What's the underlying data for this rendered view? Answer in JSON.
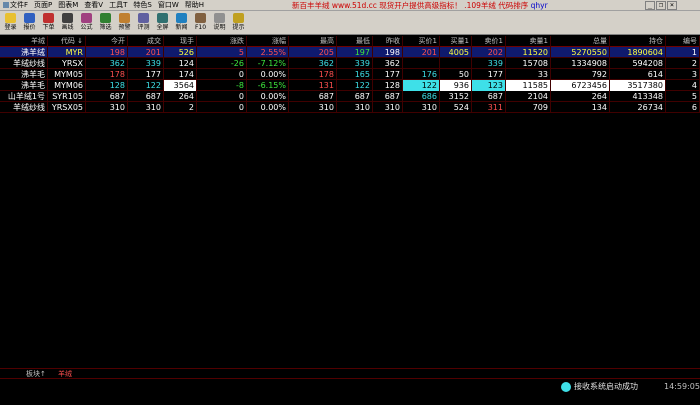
{
  "menu": [
    {
      "label": "文件F"
    },
    {
      "label": "页面P"
    },
    {
      "label": "图表M"
    },
    {
      "label": "查看V"
    },
    {
      "label": "工具T"
    },
    {
      "label": "特色S"
    },
    {
      "label": "窗口W"
    },
    {
      "label": "帮助H"
    }
  ],
  "promo": {
    "text1": "新百丰羊绒 www.51d.cc 现货开户提供高级指标！ .109羊绒 代码排序",
    "text2": "qhyr"
  },
  "window_controls": {
    "minimize": "_",
    "restore": "❐",
    "close": "×"
  },
  "toolbar": [
    {
      "label": "登录",
      "color": "#e8c030"
    },
    {
      "label": "报价",
      "color": "#3060c0"
    },
    {
      "label": "下单",
      "color": "#c03030"
    },
    {
      "label": "画线",
      "color": "#404040"
    },
    {
      "label": "公式",
      "color": "#a04080"
    },
    {
      "label": "筛选",
      "color": "#308030"
    },
    {
      "label": "预警",
      "color": "#c08030"
    },
    {
      "label": "评测",
      "color": "#6060a0"
    },
    {
      "label": "全屏",
      "color": "#307070"
    },
    {
      "label": "新闻",
      "color": "#2080c0"
    },
    {
      "label": "F10",
      "color": "#806040"
    },
    {
      "label": "说明",
      "color": "#909090"
    },
    {
      "label": "提示",
      "color": "#c0a020"
    }
  ],
  "table": {
    "columns": [
      "羊绒",
      "代码 ↓",
      "今开",
      "成交",
      "现手",
      "涨跌",
      "涨幅",
      "最高",
      "最低",
      "昨收",
      "买价1",
      "买量1",
      "卖价1",
      "卖量1",
      "总量",
      "持仓",
      "编号"
    ],
    "rows": [
      [
        "沸羊绒",
        "MYR",
        "198",
        "201",
        "526",
        "5",
        "2.55%",
        "205",
        "197",
        "198",
        "201",
        "4005",
        "202",
        "11520",
        "5270550",
        "1890604",
        "1"
      ],
      [
        "羊绒纱线",
        "YRSX",
        "362",
        "339",
        "124",
        "-26",
        "-7.12%",
        "362",
        "339",
        "362",
        "",
        "",
        "339",
        "15708",
        "1334908",
        "594208",
        "2"
      ],
      [
        "沸羊毛",
        "MYM05",
        "178",
        "177",
        "174",
        "0",
        "0.00%",
        "178",
        "165",
        "177",
        "176",
        "50",
        "177",
        "33",
        "792",
        "614",
        "3"
      ],
      [
        "沸羊毛",
        "MYM06",
        "128",
        "122",
        "3564",
        "-8",
        "-6.15%",
        "131",
        "122",
        "128",
        "122",
        "936",
        "123",
        "11585",
        "6723456",
        "3517380",
        "4"
      ],
      [
        "山羊绒1号",
        "SYR105",
        "687",
        "687",
        "264",
        "0",
        "0.00%",
        "687",
        "687",
        "687",
        "686",
        "3152",
        "687",
        "2104",
        "264",
        "413348",
        "5"
      ],
      [
        "羊绒纱线",
        "YRSX05",
        "310",
        "310",
        "2",
        "0",
        "0.00%",
        "310",
        "310",
        "310",
        "310",
        "524",
        "311",
        "709",
        "134",
        "26734",
        "6"
      ]
    ]
  },
  "tabs": [
    {
      "label": "板块↑"
    },
    {
      "label": "羊绒"
    }
  ],
  "status": {
    "message": "接收系统启动成功",
    "time": "14:59:05"
  }
}
